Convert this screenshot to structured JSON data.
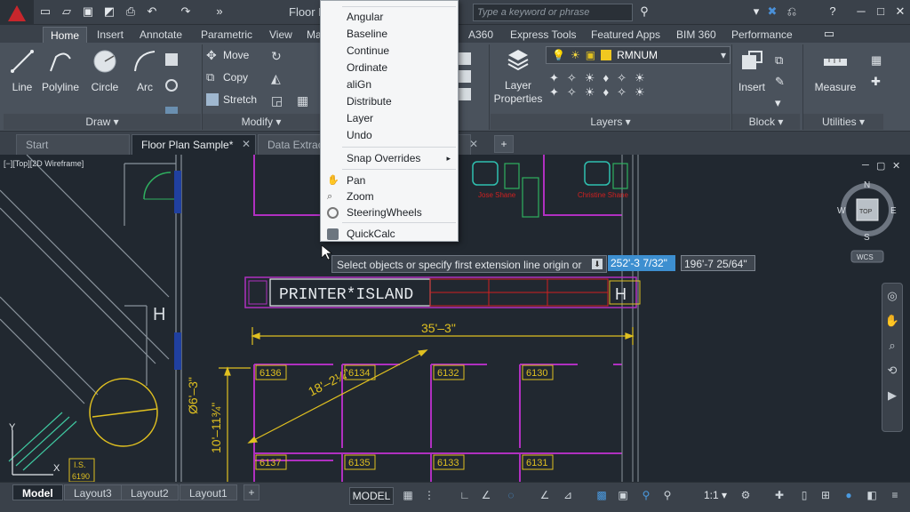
{
  "title_bar": {
    "doc_title": "Floor P",
    "search_placeholder": "Type a keyword or phrase"
  },
  "ribbon_tabs": [
    "Home",
    "Insert",
    "Annotate",
    "Parametric",
    "View",
    "Ma",
    "A360",
    "Express Tools",
    "Featured Apps",
    "BIM 360",
    "Performance"
  ],
  "draw_panel": {
    "line": "Line",
    "polyline": "Polyline",
    "circle": "Circle",
    "arc": "Arc",
    "footer": "Draw ▾"
  },
  "modify_panel": {
    "move": "Move",
    "copy": "Copy",
    "stretch": "Stretch",
    "footer": "Modify ▾"
  },
  "layers_panel": {
    "layer_properties": "Layer\nProperties",
    "current_layer": "RMNUM",
    "footer": "Layers ▾"
  },
  "block_panel": {
    "insert": "Insert",
    "footer": "Block ▾"
  },
  "utilities_panel": {
    "measure": "Measure",
    "footer": "Utilities ▾"
  },
  "file_tabs": [
    "Start",
    "Floor Plan Sample*",
    "Data Extract"
  ],
  "viewport_label": "[−][Top][2D Wireframe]",
  "context_menu": {
    "items": [
      "Angular",
      "Baseline",
      "Continue",
      "Ordinate",
      "aliGn",
      "Distribute",
      "Layer",
      "Undo"
    ],
    "snap_overrides": "Snap Overrides",
    "nav_items": [
      "Pan",
      "Zoom",
      "SteeringWheels"
    ],
    "quickcalc": "QuickCalc"
  },
  "command_prompt": "Select objects or specify first extension line origin or",
  "dynamic_input": {
    "value1": "252'-3 7/32\"",
    "value2": "196'-7 25/64\""
  },
  "drawing": {
    "printer_label": "PRINTER*ISLAND",
    "dim_horizontal": "35'–3\"",
    "dim_diagonal": "18'–2¼\"",
    "dim_vertical": "10'–11¾\"",
    "dim_diameter": "Ø6'–3\"",
    "rooms_top": [
      "6136",
      "6134",
      "6132",
      "6130"
    ],
    "rooms_bottom": [
      "6137",
      "6135",
      "6133",
      "6131"
    ],
    "is_label": "I.S.",
    "is_number": "6190",
    "red_text_1": "Jose Shane",
    "red_text_2": "Christine Shane"
  },
  "viewcube": {
    "north": "N",
    "south": "S",
    "east": "E",
    "west": "W",
    "face": "TOP",
    "ucs": "WCS"
  },
  "layout_tabs": [
    "Model",
    "Layout3",
    "Layout2",
    "Layout1"
  ],
  "status": {
    "model": "MODEL",
    "scale": "1:1 ▾"
  },
  "colors": {
    "accent": "#3d8fd0",
    "wall": "#b030c0",
    "dim": "#e0c020",
    "red": "#d02020"
  }
}
